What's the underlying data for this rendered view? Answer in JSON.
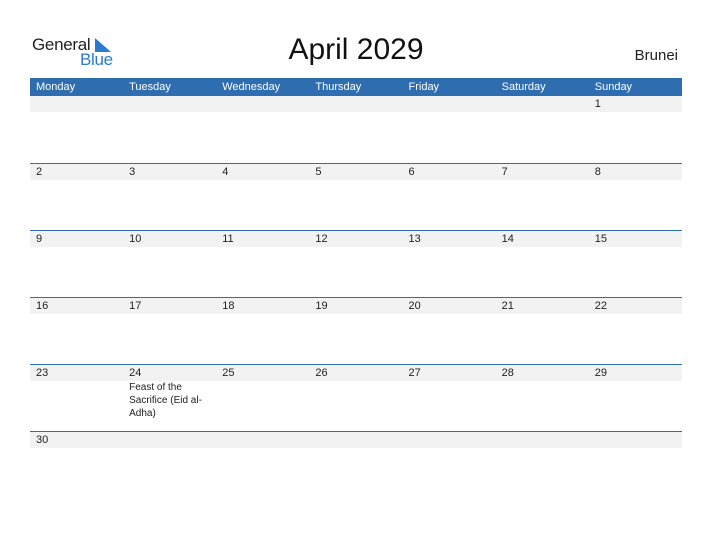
{
  "logo": {
    "general": "General",
    "blue": "Blue"
  },
  "title": "April 2029",
  "country": "Brunei",
  "weekdays": [
    "Monday",
    "Tuesday",
    "Wednesday",
    "Thursday",
    "Friday",
    "Saturday",
    "Sunday"
  ],
  "weeks": [
    [
      {
        "d": ""
      },
      {
        "d": ""
      },
      {
        "d": ""
      },
      {
        "d": ""
      },
      {
        "d": ""
      },
      {
        "d": ""
      },
      {
        "d": "1"
      }
    ],
    [
      {
        "d": "2"
      },
      {
        "d": "3"
      },
      {
        "d": "4"
      },
      {
        "d": "5"
      },
      {
        "d": "6"
      },
      {
        "d": "7"
      },
      {
        "d": "8"
      }
    ],
    [
      {
        "d": "9"
      },
      {
        "d": "10"
      },
      {
        "d": "11"
      },
      {
        "d": "12"
      },
      {
        "d": "13"
      },
      {
        "d": "14"
      },
      {
        "d": "15"
      }
    ],
    [
      {
        "d": "16"
      },
      {
        "d": "17"
      },
      {
        "d": "18"
      },
      {
        "d": "19"
      },
      {
        "d": "20"
      },
      {
        "d": "21"
      },
      {
        "d": "22"
      }
    ],
    [
      {
        "d": "23"
      },
      {
        "d": "24",
        "event": "Feast of the Sacrifice (Eid al-Adha)"
      },
      {
        "d": "25"
      },
      {
        "d": "26"
      },
      {
        "d": "27"
      },
      {
        "d": "28"
      },
      {
        "d": "29"
      }
    ],
    [
      {
        "d": "30"
      },
      {
        "d": ""
      },
      {
        "d": ""
      },
      {
        "d": ""
      },
      {
        "d": ""
      },
      {
        "d": ""
      },
      {
        "d": ""
      }
    ]
  ],
  "colors": {
    "header": "#2e6db0",
    "accent": "#2a7bd0",
    "strip": "#f2f2f2"
  }
}
